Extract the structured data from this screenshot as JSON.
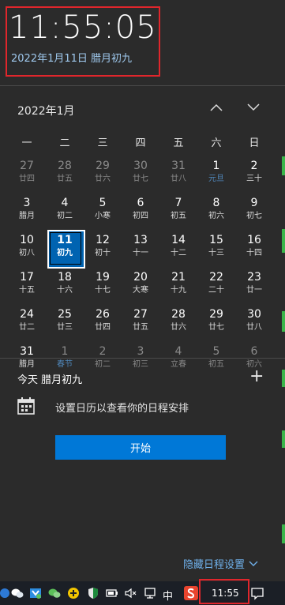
{
  "clock": {
    "time": "11:55:05",
    "date": "2022年1月11日 腊月初九"
  },
  "calendar": {
    "month_label": "2022年1月",
    "weekdays": [
      "一",
      "二",
      "三",
      "四",
      "五",
      "六",
      "日"
    ],
    "days": [
      {
        "day": "27",
        "lunar": "廿四",
        "dim": true
      },
      {
        "day": "28",
        "lunar": "廿五",
        "dim": true
      },
      {
        "day": "29",
        "lunar": "廿六",
        "dim": true
      },
      {
        "day": "30",
        "lunar": "廿七",
        "dim": true
      },
      {
        "day": "31",
        "lunar": "廿八",
        "dim": true
      },
      {
        "day": "1",
        "lunar": "元旦",
        "blue": true
      },
      {
        "day": "2",
        "lunar": "三十"
      },
      {
        "day": "3",
        "lunar": "腊月"
      },
      {
        "day": "4",
        "lunar": "初二"
      },
      {
        "day": "5",
        "lunar": "小寒"
      },
      {
        "day": "6",
        "lunar": "初四"
      },
      {
        "day": "7",
        "lunar": "初五"
      },
      {
        "day": "8",
        "lunar": "初六"
      },
      {
        "day": "9",
        "lunar": "初七"
      },
      {
        "day": "10",
        "lunar": "初八"
      },
      {
        "day": "11",
        "lunar": "初九",
        "today": true
      },
      {
        "day": "12",
        "lunar": "初十"
      },
      {
        "day": "13",
        "lunar": "十一"
      },
      {
        "day": "14",
        "lunar": "十二"
      },
      {
        "day": "15",
        "lunar": "十三"
      },
      {
        "day": "16",
        "lunar": "十四"
      },
      {
        "day": "17",
        "lunar": "十五"
      },
      {
        "day": "18",
        "lunar": "十六"
      },
      {
        "day": "19",
        "lunar": "十七"
      },
      {
        "day": "20",
        "lunar": "大寒"
      },
      {
        "day": "21",
        "lunar": "十九"
      },
      {
        "day": "22",
        "lunar": "二十"
      },
      {
        "day": "23",
        "lunar": "廿一"
      },
      {
        "day": "24",
        "lunar": "廿二"
      },
      {
        "day": "25",
        "lunar": "廿三"
      },
      {
        "day": "26",
        "lunar": "廿四"
      },
      {
        "day": "27",
        "lunar": "廿五"
      },
      {
        "day": "28",
        "lunar": "廿六"
      },
      {
        "day": "29",
        "lunar": "廿七"
      },
      {
        "day": "30",
        "lunar": "廿八"
      },
      {
        "day": "31",
        "lunar": "腊月"
      },
      {
        "day": "1",
        "lunar": "春节",
        "dim": true,
        "blue": true
      },
      {
        "day": "2",
        "lunar": "初二",
        "dim": true
      },
      {
        "day": "3",
        "lunar": "初三",
        "dim": true
      },
      {
        "day": "4",
        "lunar": "立春",
        "dim": true
      },
      {
        "day": "5",
        "lunar": "初五",
        "dim": true
      },
      {
        "day": "6",
        "lunar": "初六",
        "dim": true
      }
    ]
  },
  "agenda": {
    "title": "今天 腊月初九",
    "add_label": "+",
    "message": "设置日历以查看你的日程安排",
    "start_label": "开始"
  },
  "hide_link": "隐藏日程设置",
  "taskbar": {
    "ime": "中",
    "clock": "11:55"
  },
  "colors": {
    "accent": "#0078d7",
    "today_bg": "#0063b1",
    "highlight_box": "#e0262c",
    "link": "#6fb0ea"
  }
}
